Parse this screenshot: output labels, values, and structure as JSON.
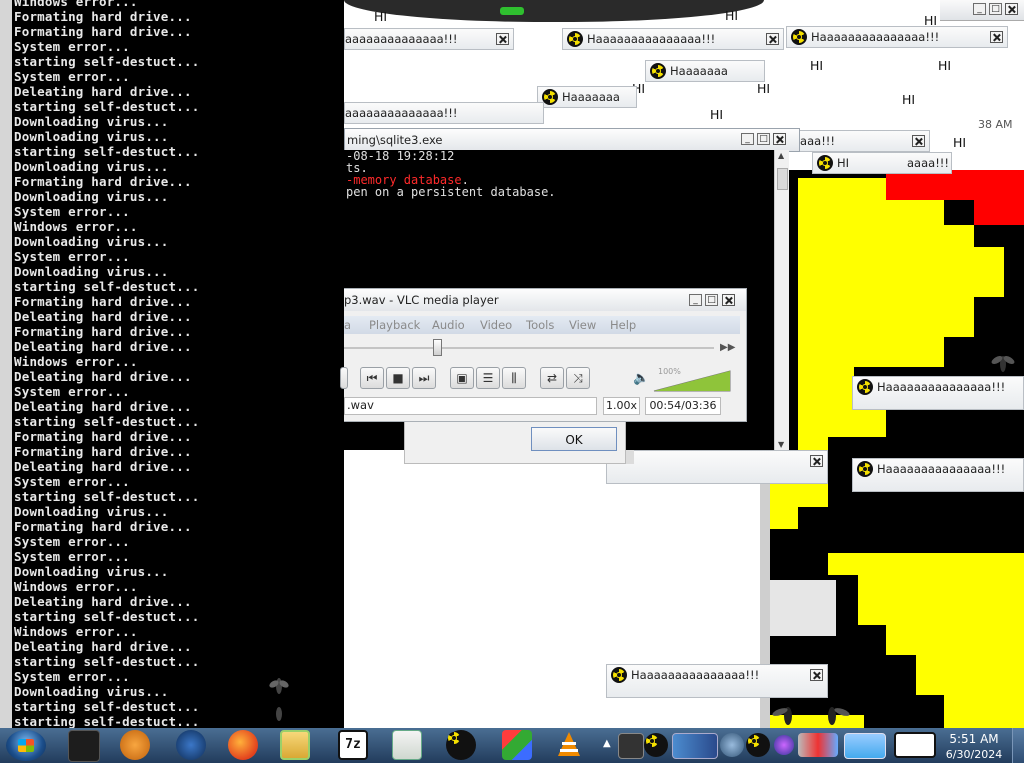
{
  "console": {
    "lines": [
      "Windows error...",
      "Formating hard drive...",
      "Formating hard drive...",
      "System error...",
      "starting self-destuct...",
      "System error...",
      "Deleating hard drive...",
      "starting self-destuct...",
      "Downloading virus...",
      "Downloading virus...",
      "starting self-destuct...",
      "Downloading virus...",
      "Formating hard drive...",
      "Downloading virus...",
      "System error...",
      "Windows error...",
      "Downloading virus...",
      "System error...",
      "Downloading virus...",
      "starting self-destuct...",
      "Formating hard drive...",
      "Deleating hard drive...",
      "Formating hard drive...",
      "Deleating hard drive...",
      "Windows error...",
      "Deleating hard drive...",
      "System error...",
      "Deleating hard drive...",
      "starting self-destuct...",
      "Formating hard drive...",
      "Formating hard drive...",
      "Deleating hard drive...",
      "System error...",
      "starting self-destuct...",
      "Downloading virus...",
      "Formating hard drive...",
      "System error...",
      "System error...",
      "Downloading virus...",
      "Windows error...",
      "Deleating hard drive...",
      "starting self-destuct...",
      "Windows error...",
      "Deleating hard drive...",
      "starting self-destuct...",
      "System error...",
      "Downloading virus...",
      "starting self-destuct...",
      "starting self-destuct..."
    ]
  },
  "popups": {
    "full_text": "Haaaaaaaaaaaaaaa!!!",
    "partial_text": "aaaaaaaaaaaaaa!!!",
    "partial2_text": "Haaaaaaa",
    "short_text": "aaaa!!!",
    "short2_text": "aaaa!!!",
    "hi": "HI"
  },
  "sqlite": {
    "title": "ming\\sqlite3.exe",
    "line1": "-08-18 19:28:12",
    "line2": "ts.",
    "line3_red": "-memory database",
    "line3_end": ".",
    "line4": "pen on a persistent database."
  },
  "vlc": {
    "title": "p3.wav - VLC media player",
    "menu": [
      "a",
      "Playback",
      "Audio",
      "Video",
      "Tools",
      "View",
      "Help"
    ],
    "filename": ".wav",
    "speed": "1.00x",
    "time": "00:54/03:36",
    "volume": "100%",
    "volume_level": 1.0,
    "seek_position": 0.24
  },
  "dialog": {
    "ok_label": "OK"
  },
  "clock": {
    "time": "5:51 AM",
    "date": "6/30/2024",
    "partial_time": "38 AM"
  },
  "colors": {
    "taskbar": "#2a4a6e",
    "console_bg": "#000000",
    "pacman_yellow": "#ffff00",
    "red": "#ff0000"
  }
}
